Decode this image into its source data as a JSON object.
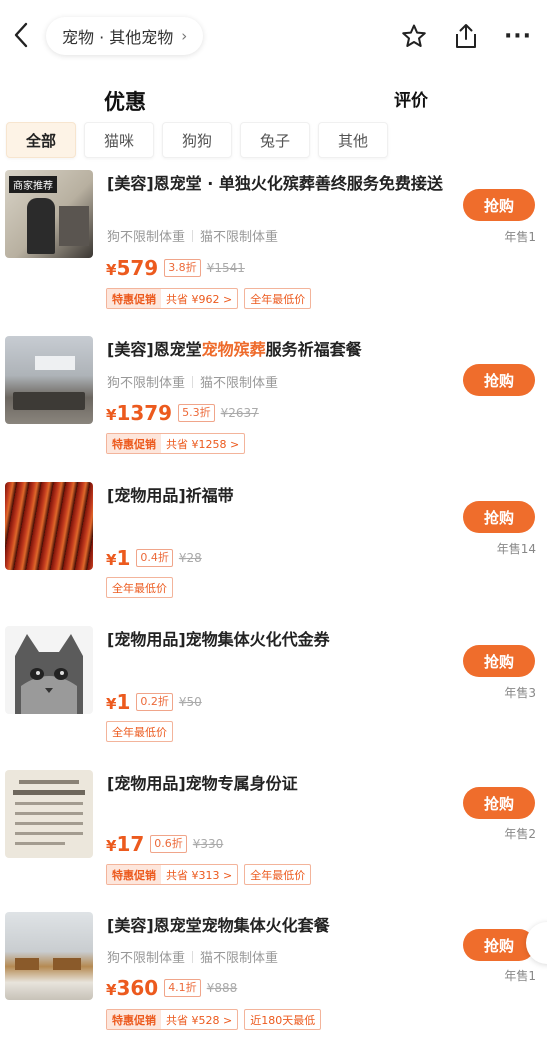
{
  "header": {
    "breadcrumb": "宠物 · 其他宠物",
    "back_icon": "chevron-left-icon",
    "actions": [
      "star-icon",
      "share-icon",
      "more-icon"
    ],
    "more_label": "···"
  },
  "sections": {
    "deals": "优惠",
    "reviews": "评价"
  },
  "filters": [
    "全部",
    "猫咪",
    "狗狗",
    "兔子",
    "其他"
  ],
  "colors": {
    "accent": "#ef6d2c",
    "price": "#ec5a1e",
    "highlight_underline": "#f5c842"
  },
  "products": [
    {
      "title": "[美容]恩宠堂 · 单独火化殡葬善终服务免费接送",
      "thumb_caption": "商家推荐",
      "specs": [
        "狗不限制体重",
        "猫不限制体重"
      ],
      "price_symbol": "¥",
      "price": "579",
      "discount": "3.8折",
      "original": "¥1541",
      "tags": [
        {
          "badge": "特惠促销",
          "text": "共省 ¥962 >"
        },
        {
          "badge": "",
          "text": "全年最低价"
        }
      ],
      "buy": "抢购",
      "sold": "年售1"
    },
    {
      "title_prefix": "[美容]恩宠堂",
      "title_highlight": "宠物殡葬",
      "title_suffix": "服务祈福套餐",
      "specs": [
        "狗不限制体重",
        "猫不限制体重"
      ],
      "price_symbol": "¥",
      "price": "1379",
      "discount": "5.3折",
      "original": "¥2637",
      "tags": [
        {
          "badge": "特惠促销",
          "text": "共省 ¥1258 >"
        }
      ],
      "buy": "抢购",
      "sold": ""
    },
    {
      "title": "[宠物用品]祈福带",
      "specs": [],
      "price_symbol": "¥",
      "price": "1",
      "discount": "0.4折",
      "original": "¥28",
      "tags": [
        {
          "badge": "",
          "text": "全年最低价"
        }
      ],
      "buy": "抢购",
      "sold": "年售14"
    },
    {
      "title": "[宠物用品]宠物集体火化代金券",
      "specs": [],
      "price_symbol": "¥",
      "price": "1",
      "discount": "0.2折",
      "original": "¥50",
      "tags": [
        {
          "badge": "",
          "text": "全年最低价"
        }
      ],
      "buy": "抢购",
      "sold": "年售3"
    },
    {
      "title": "[宠物用品]宠物专属身份证",
      "specs": [],
      "price_symbol": "¥",
      "price": "17",
      "discount": "0.6折",
      "original": "¥330",
      "tags": [
        {
          "badge": "特惠促销",
          "text": "共省 ¥313 >"
        },
        {
          "badge": "",
          "text": "全年最低价"
        }
      ],
      "buy": "抢购",
      "sold": "年售2"
    },
    {
      "title": "[美容]恩宠堂宠物集体火化套餐",
      "specs": [
        "狗不限制体重",
        "猫不限制体重"
      ],
      "price_symbol": "¥",
      "price": "360",
      "discount": "4.1折",
      "original": "¥888",
      "tags": [
        {
          "badge": "特惠促销",
          "text": "共省 ¥528 >"
        },
        {
          "badge": "",
          "text": "近180天最低"
        }
      ],
      "buy": "抢购",
      "sold": "年售1"
    }
  ]
}
